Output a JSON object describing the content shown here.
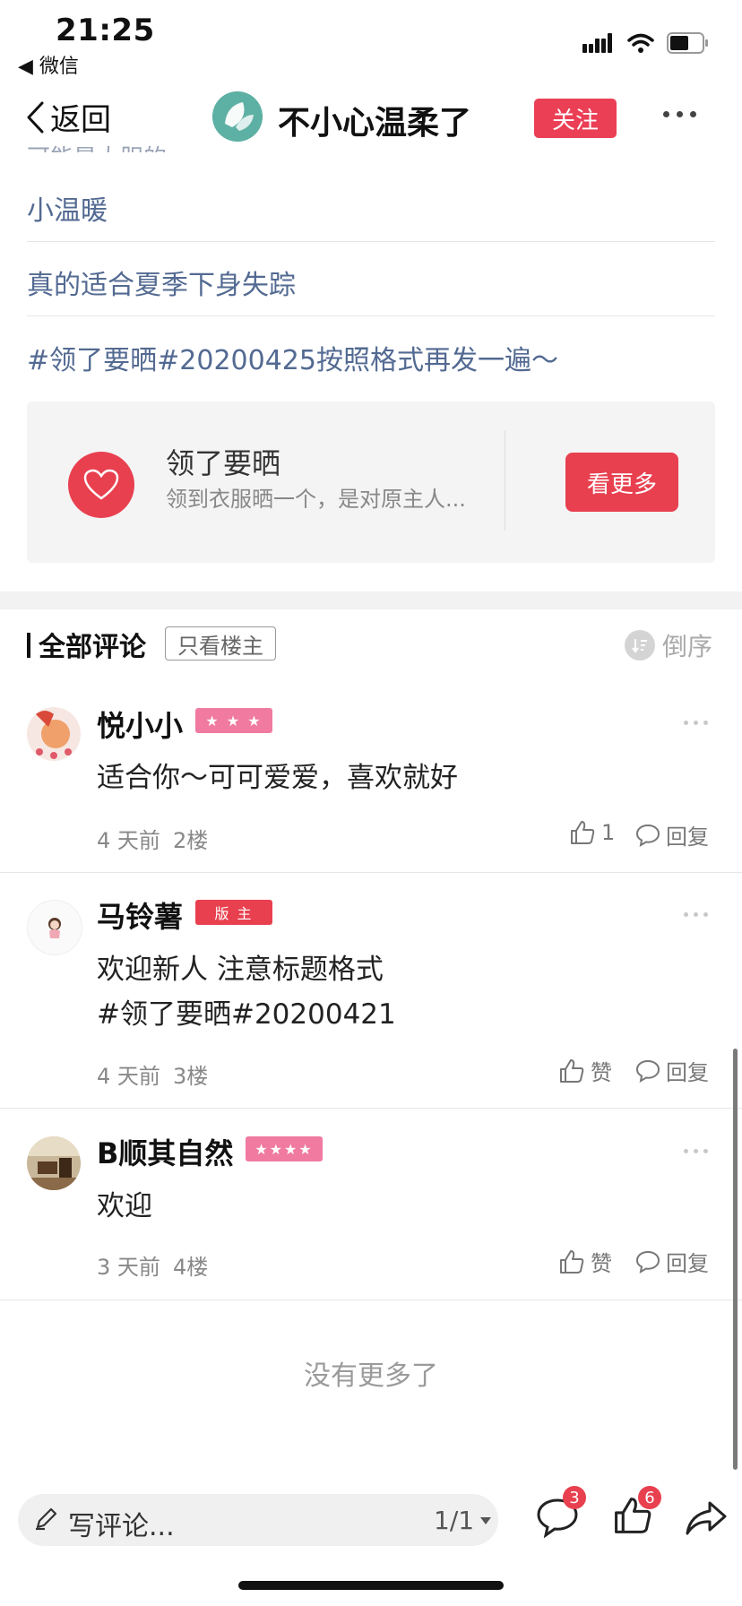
{
  "status_bar": {
    "time": "21:25",
    "back_app": "◀ 微信"
  },
  "nav": {
    "back_label": "返回",
    "title": "不小心温柔了",
    "follow_label": "关注"
  },
  "links": {
    "partial": "可能是大胆的",
    "items": [
      "小温暖",
      "真的适合夏季下身失踪",
      "#领了要晒#20200425按照格式再发一遍～"
    ]
  },
  "topic_card": {
    "name": "领了要晒",
    "description": "领到衣服晒一个，是对原主人...",
    "see_more_label": "看更多"
  },
  "comments_header": {
    "title": "全部评论",
    "owner_only_label": "只看楼主",
    "sort_label": "倒序"
  },
  "comments": [
    {
      "name": "悦小小",
      "badge": "★ ★ ★",
      "text": "适合你～可可爱爱，喜欢就好",
      "text2": "",
      "time": "4 天前",
      "floor": "2楼",
      "like": "1",
      "reply": "回复"
    },
    {
      "name": "马铃薯",
      "badge": "版 主",
      "text": "欢迎新人 注意标题格式",
      "text2": "#领了要晒#20200421",
      "time": "4 天前",
      "floor": "3楼",
      "like": "赞",
      "reply": "回复"
    },
    {
      "name": "B顺其自然",
      "badge": "★★★★",
      "text": "欢迎",
      "text2": "",
      "time": "3 天前",
      "floor": "4楼",
      "like": "赞",
      "reply": "回复"
    }
  ],
  "no_more": "没有更多了",
  "bottom_bar": {
    "input_placeholder": "写评论...",
    "page_indicator": "1/1",
    "comment_count": "3",
    "like_count": "6"
  },
  "colors": {
    "accent": "#e8404f",
    "link": "#536a92",
    "badge_pink": "#f07aa0"
  }
}
